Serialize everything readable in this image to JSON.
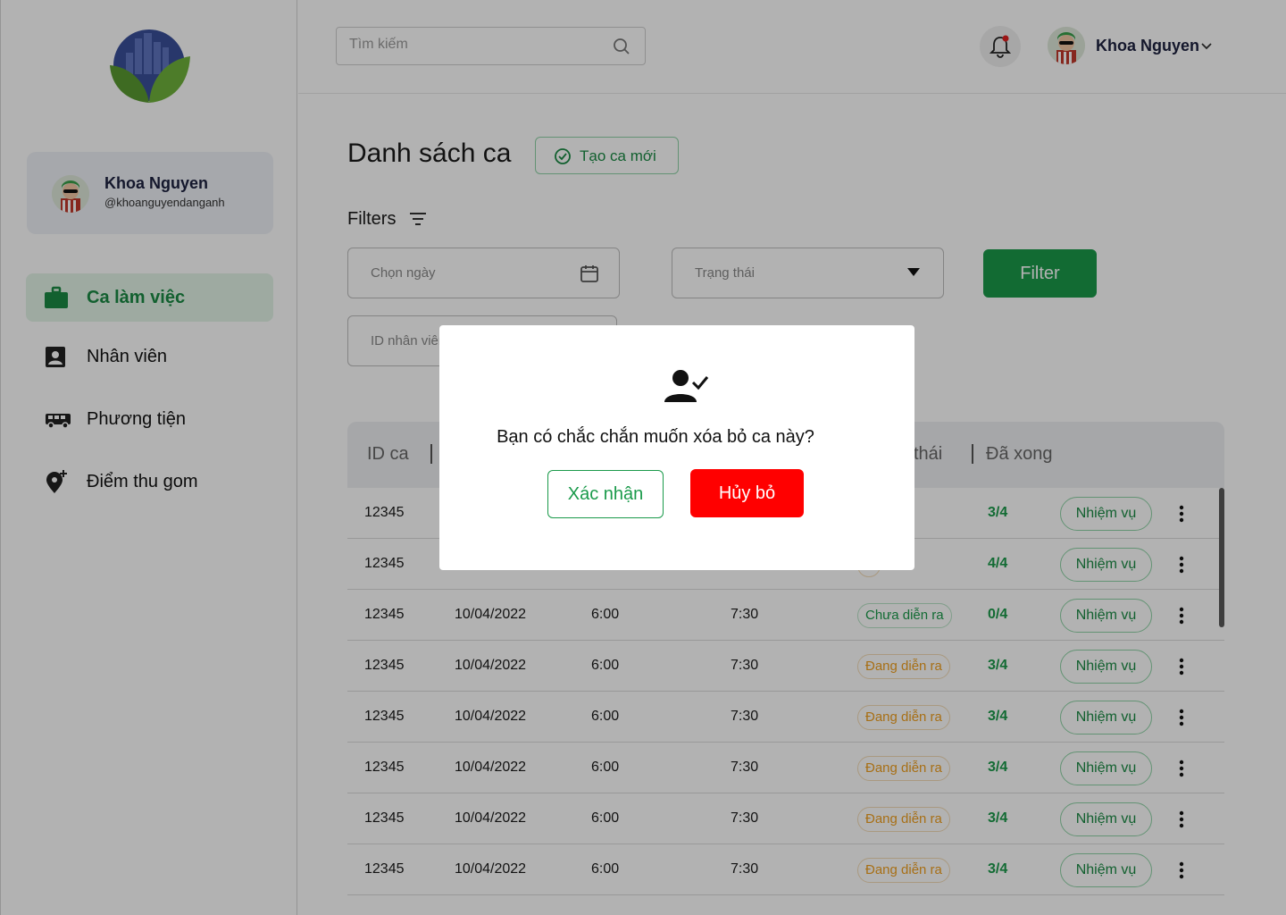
{
  "colors": {
    "accent_green": "#1a9a4a",
    "pending_orange": "#f0a020",
    "danger_red": "#ff0000",
    "overlay": "rgba(0,0,0,0.3)"
  },
  "user": {
    "name": "Khoa Nguyen",
    "handle": "@khoanguyendanganh"
  },
  "sidebar": {
    "items": [
      {
        "label": "Ca làm việc",
        "icon": "briefcase-icon",
        "active": true
      },
      {
        "label": "Nhân viên",
        "icon": "contact-card-icon",
        "active": false
      },
      {
        "label": "Phương tiện",
        "icon": "bus-icon",
        "active": false
      },
      {
        "label": "Điểm thu gom",
        "icon": "add-location-icon",
        "active": false
      }
    ]
  },
  "header": {
    "search_placeholder": "Tìm kiếm",
    "user_name": "Khoa Nguyen"
  },
  "main": {
    "title": "Danh sách ca",
    "create_label": "Tạo ca mới",
    "filters_label": "Filters",
    "date_placeholder": "Chọn ngày",
    "status_placeholder": "Trạng thái",
    "employee_id_placeholder": "ID nhân viên",
    "filter_button": "Filter"
  },
  "table": {
    "headers": {
      "id": "ID ca",
      "status": "thái",
      "done": "Đã xong"
    },
    "task_label": "Nhiệm vụ",
    "rows": [
      {
        "id": "12345",
        "date": "",
        "start": "",
        "end": "",
        "status": "ễn ra",
        "status_type": "ongoing",
        "progress": "3/4"
      },
      {
        "id": "12345",
        "date": "",
        "start": "",
        "end": "",
        "status": "c",
        "status_type": "other",
        "progress": "4/4"
      },
      {
        "id": "12345",
        "date": "10/04/2022",
        "start": "6:00",
        "end": "7:30",
        "status": "Chưa diễn ra",
        "status_type": "upcoming",
        "progress": "0/4"
      },
      {
        "id": "12345",
        "date": "10/04/2022",
        "start": "6:00",
        "end": "7:30",
        "status": "Đang diễn ra",
        "status_type": "ongoing",
        "progress": "3/4"
      },
      {
        "id": "12345",
        "date": "10/04/2022",
        "start": "6:00",
        "end": "7:30",
        "status": "Đang diễn ra",
        "status_type": "ongoing",
        "progress": "3/4"
      },
      {
        "id": "12345",
        "date": "10/04/2022",
        "start": "6:00",
        "end": "7:30",
        "status": "Đang diễn ra",
        "status_type": "ongoing",
        "progress": "3/4"
      },
      {
        "id": "12345",
        "date": "10/04/2022",
        "start": "6:00",
        "end": "7:30",
        "status": "Đang diễn ra",
        "status_type": "ongoing",
        "progress": "3/4"
      },
      {
        "id": "12345",
        "date": "10/04/2022",
        "start": "6:00",
        "end": "7:30",
        "status": "Đang diễn ra",
        "status_type": "ongoing",
        "progress": "3/4"
      }
    ]
  },
  "modal": {
    "icon": "user-check-icon",
    "message": "Bạn có chắc chắn muốn xóa bỏ ca này?",
    "confirm_label": "Xác nhận",
    "cancel_label": "Hủy bỏ"
  }
}
